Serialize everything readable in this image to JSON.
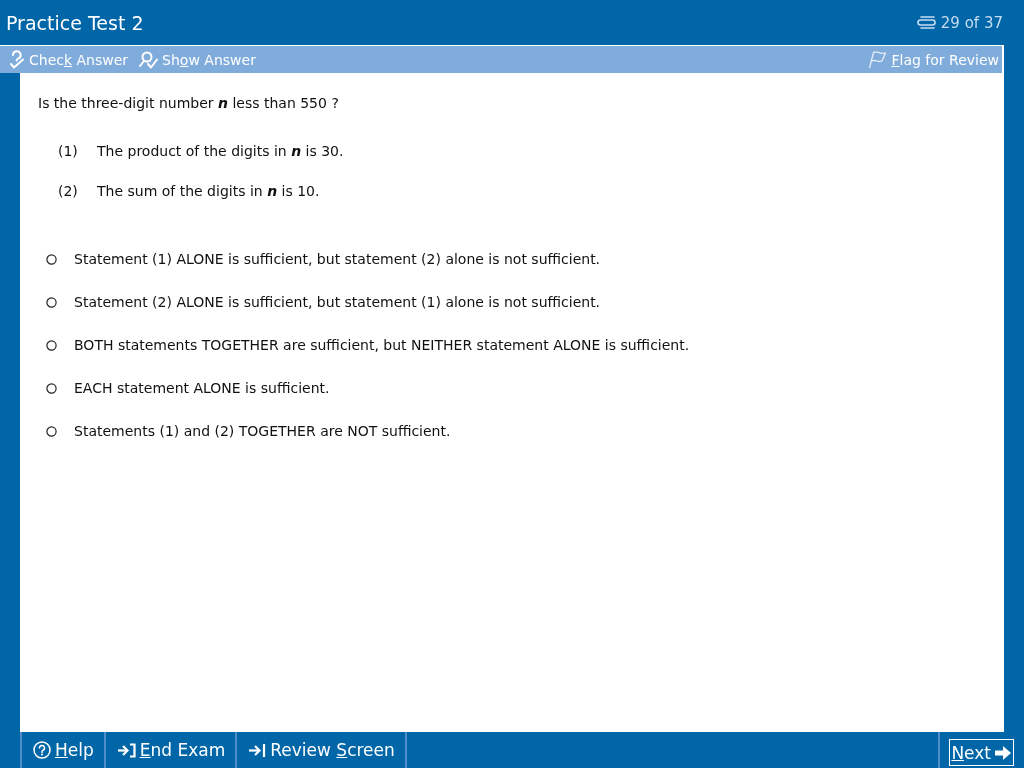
{
  "window": {
    "title": "Practice Test 2",
    "counter": "29 of 37"
  },
  "toolbar": {
    "check_answer_button": {
      "pre": "Chec",
      "key": "k",
      "post": " Answer"
    },
    "show_answer_button": {
      "pre": "Sh",
      "key": "o",
      "post": "w Answer"
    },
    "flag_for_review_button": {
      "key": "F",
      "post": "lag for Review"
    }
  },
  "question": {
    "stem": "Is the three-digit number **n** less than 550 ?",
    "statements": [
      {
        "number": "(1)",
        "text": "The product of the digits in **n** is 30."
      },
      {
        "number": "(2)",
        "text": "The sum of the digits in **n** is 10."
      }
    ],
    "options": [
      {
        "text": "Statement (1) ALONE is sufficient, but statement (2) alone is not sufficient.",
        "selected": false
      },
      {
        "text": "Statement (2) ALONE is sufficient, but statement (1) alone is not sufficient.",
        "selected": false
      },
      {
        "text": "BOTH statements TOGETHER are sufficient, but NEITHER statement ALONE is sufficient.",
        "selected": false
      },
      {
        "text": "EACH statement ALONE is sufficient.",
        "selected": false
      },
      {
        "text": "Statements (1) and (2) TOGETHER are NOT sufficient.",
        "selected": false
      }
    ]
  },
  "footer": {
    "help_button": {
      "key": "H",
      "post": "elp"
    },
    "end_exam_button": {
      "key": "E",
      "post": "nd Exam"
    },
    "review_screen_button": {
      "pre": "Review ",
      "key": "S",
      "post": "creen"
    },
    "next_button": {
      "key": "N",
      "post": "ext"
    }
  }
}
